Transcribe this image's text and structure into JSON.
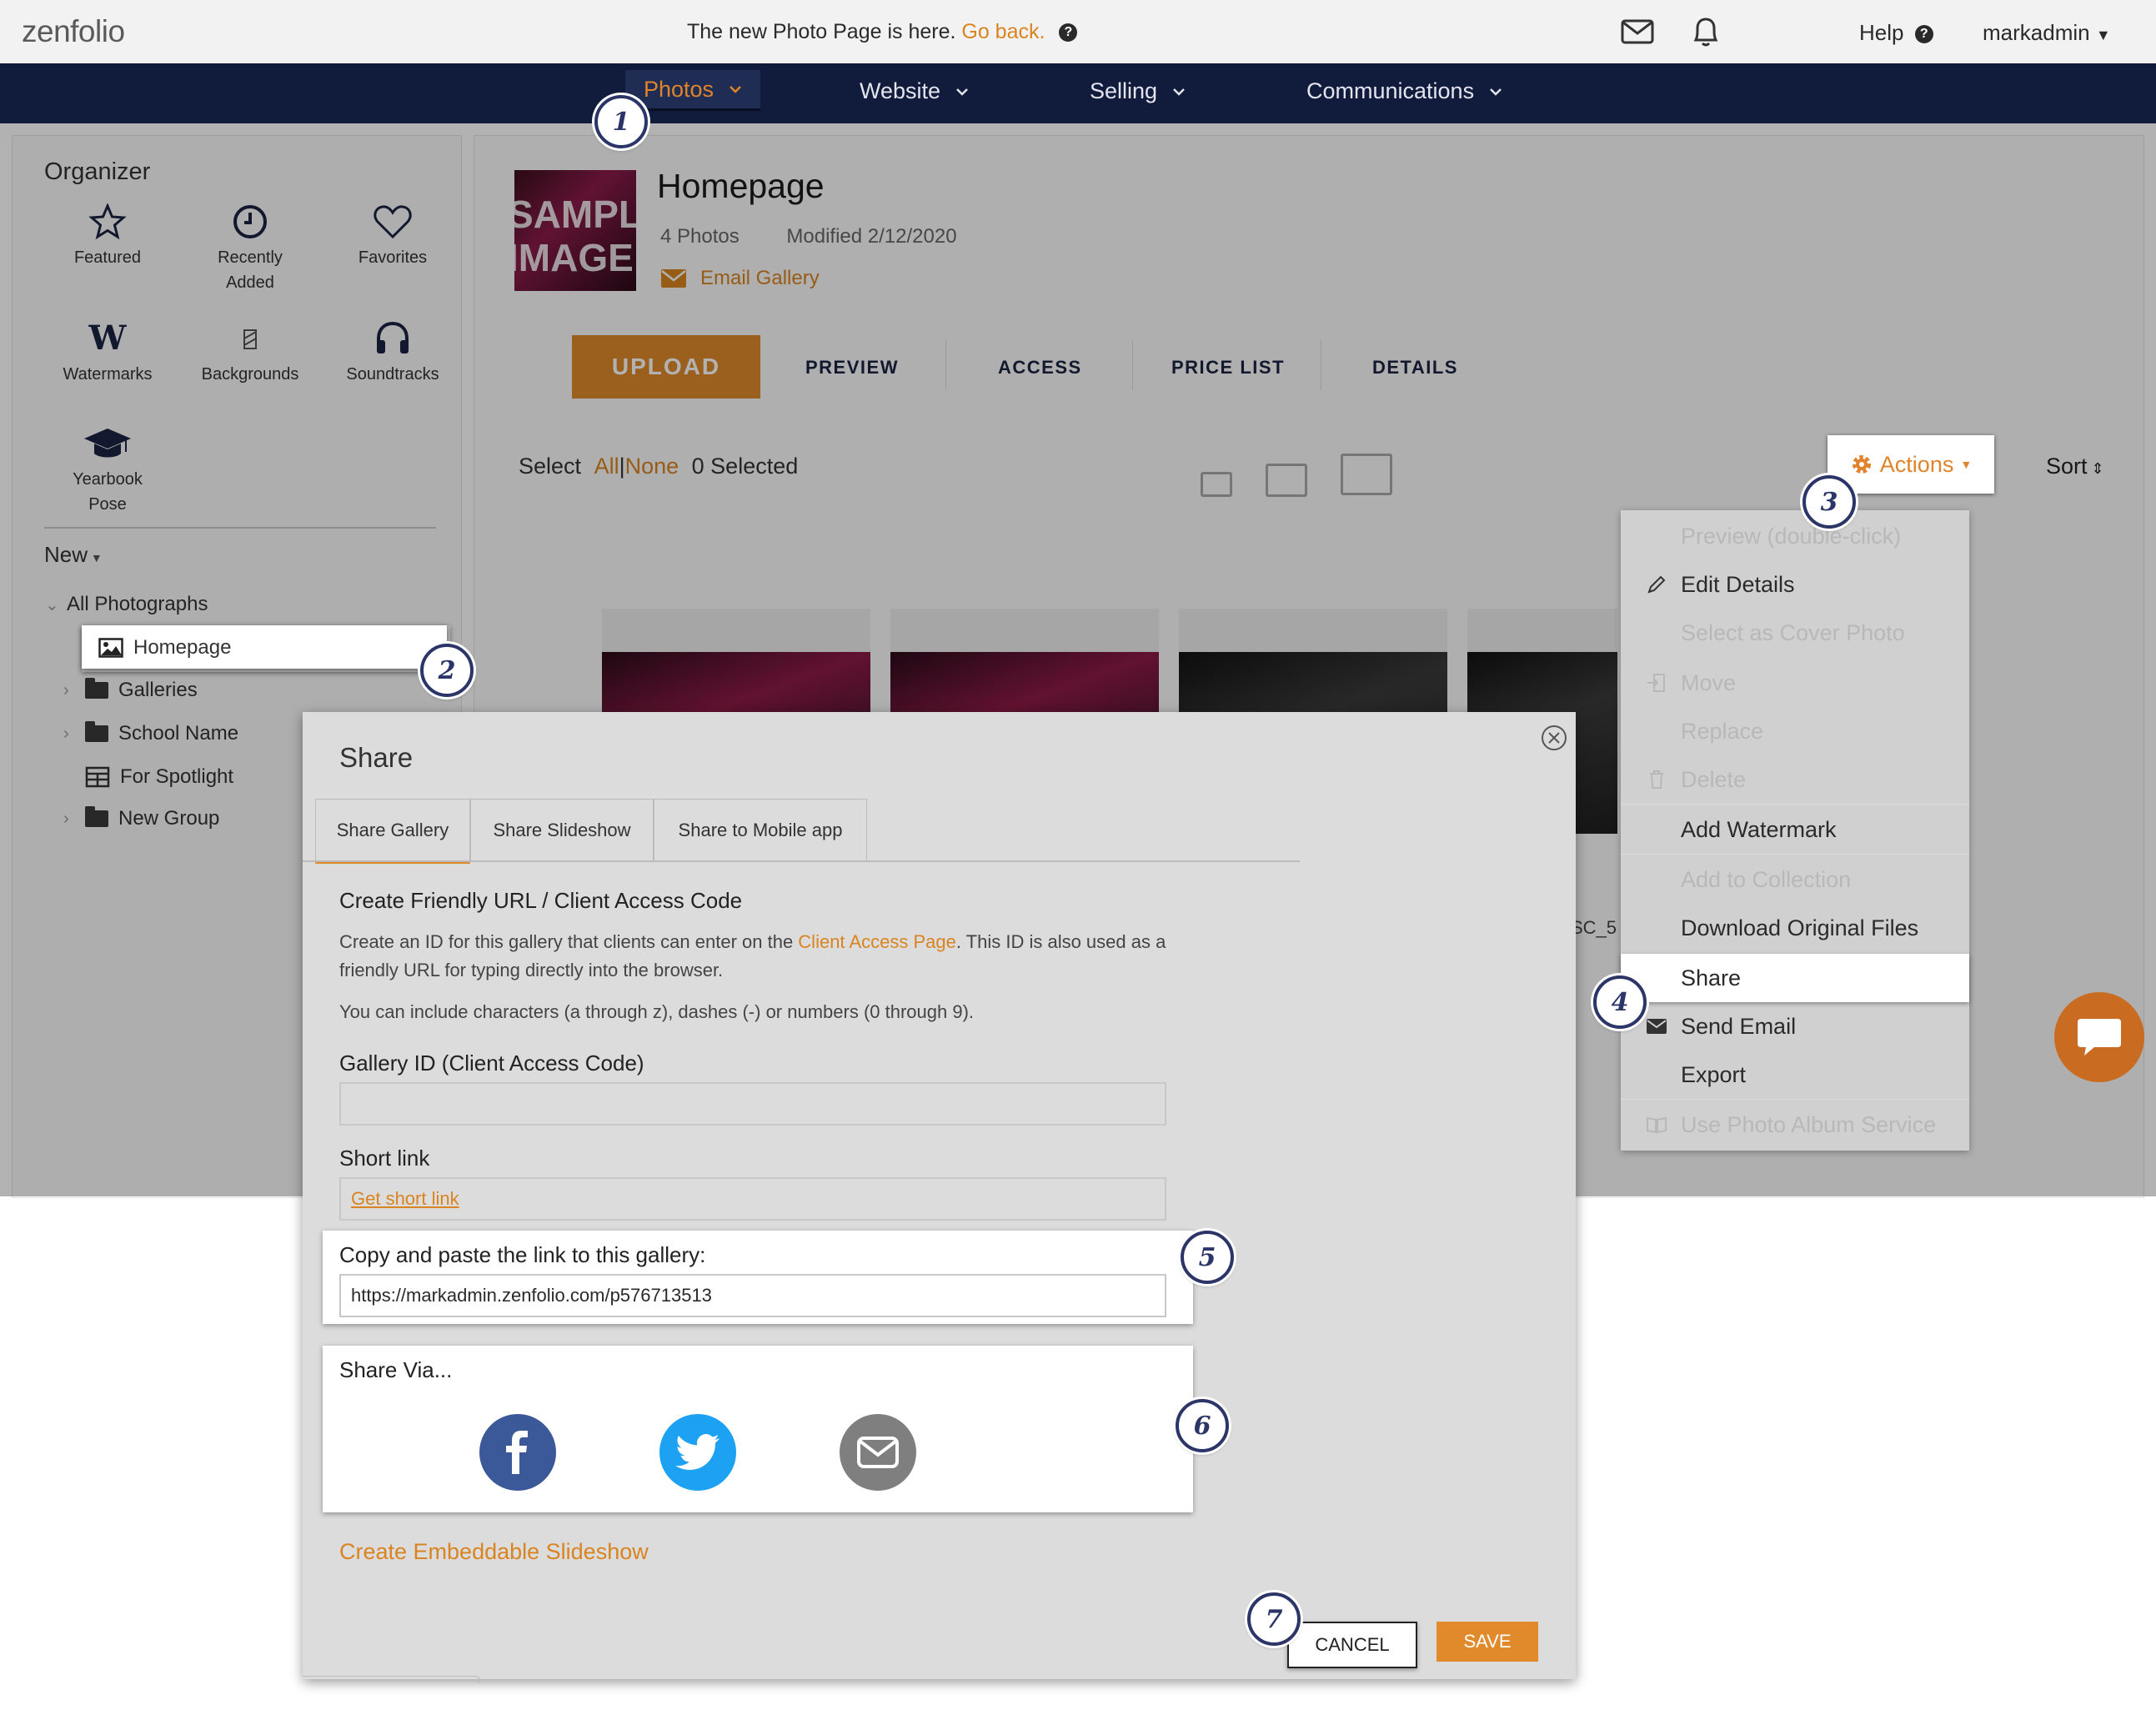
{
  "header": {
    "logo": "zenfolio",
    "notice": "The new Photo Page is here.",
    "notice_link": "Go back.",
    "help": "Help",
    "username": "markadmin"
  },
  "nav": [
    "Photos",
    "Website",
    "Selling",
    "Communications"
  ],
  "organizer": {
    "title": "Organizer",
    "items": [
      "Featured",
      "Recently Added",
      "Favorites",
      "Watermarks",
      "Backgrounds",
      "Soundtracks",
      "Yearbook Pose"
    ],
    "new_label": "New",
    "tree": [
      "All Photographs",
      "Homepage",
      "Galleries",
      "School Name",
      "For Spotlight",
      "New Group"
    ]
  },
  "gallery": {
    "thumb_text": [
      "SAMPLE",
      "IMAGE"
    ],
    "title": "Homepage",
    "photo_count": "4 Photos",
    "modified": "Modified 2/12/2020",
    "email_link": "Email Gallery",
    "upload": "UPLOAD",
    "tabs": [
      "PREVIEW",
      "ACCESS",
      "PRICE LIST",
      "DETAILS"
    ],
    "select": "Select",
    "all": "All",
    "none": "None",
    "selected": "0 Selected",
    "actions": "Actions",
    "sort": "Sort",
    "photo_label": "SC_5"
  },
  "actions_menu": [
    {
      "label": "Preview (double-click)",
      "enabled": false
    },
    {
      "label": "Edit Details",
      "enabled": true,
      "icon": "pencil-icon"
    },
    {
      "label": "Select as Cover Photo",
      "enabled": false
    },
    {
      "label": "Move",
      "enabled": false,
      "icon": "move-icon"
    },
    {
      "label": "Replace",
      "enabled": false
    },
    {
      "label": "Delete",
      "enabled": false,
      "icon": "trash-icon"
    },
    {
      "label": "Add Watermark",
      "enabled": true
    },
    {
      "label": "Add to Collection",
      "enabled": false
    },
    {
      "label": "Download Original Files",
      "enabled": true
    },
    {
      "label": "Share",
      "enabled": true,
      "highlighted": true
    },
    {
      "label": "Send Email",
      "enabled": true,
      "icon": "envelope-icon"
    },
    {
      "label": "Export",
      "enabled": true
    },
    {
      "label": "Use Photo Album Service",
      "enabled": false,
      "icon": "book-icon"
    }
  ],
  "modal": {
    "title": "Share",
    "tabs": [
      "Share Gallery",
      "Share Slideshow",
      "Share to Mobile app"
    ],
    "section_title": "Create Friendly URL / Client Access Code",
    "desc_before": "Create an ID for this gallery that clients can enter on the ",
    "desc_link": "Client Access Page",
    "desc_after": ". This ID is also used as a friendly URL for typing directly into the browser.",
    "desc2": "You can include characters (a through z), dashes (-) or numbers (0 through 9).",
    "gallery_id_label": "Gallery ID (Client Access Code)",
    "gallery_id_value": "",
    "short_link_label": "Short link",
    "short_link_action": "Get short link",
    "copy_label": "Copy and paste the link to this gallery:",
    "gallery_url": "https://markadmin.zenfolio.com/p576713513",
    "share_via": "Share Via...",
    "social": [
      "facebook-icon",
      "twitter-icon",
      "email-icon"
    ],
    "embed_link": "Create Embeddable Slideshow",
    "cancel": "CANCEL",
    "save": "SAVE"
  },
  "badges": [
    "1",
    "2",
    "3",
    "4",
    "5",
    "6",
    "7"
  ],
  "colors": {
    "accent": "#e0832a",
    "nav_bg": "#111c3c",
    "badge": "#2b3568",
    "facebook": "#3b5998",
    "twitter": "#1da1f2"
  }
}
